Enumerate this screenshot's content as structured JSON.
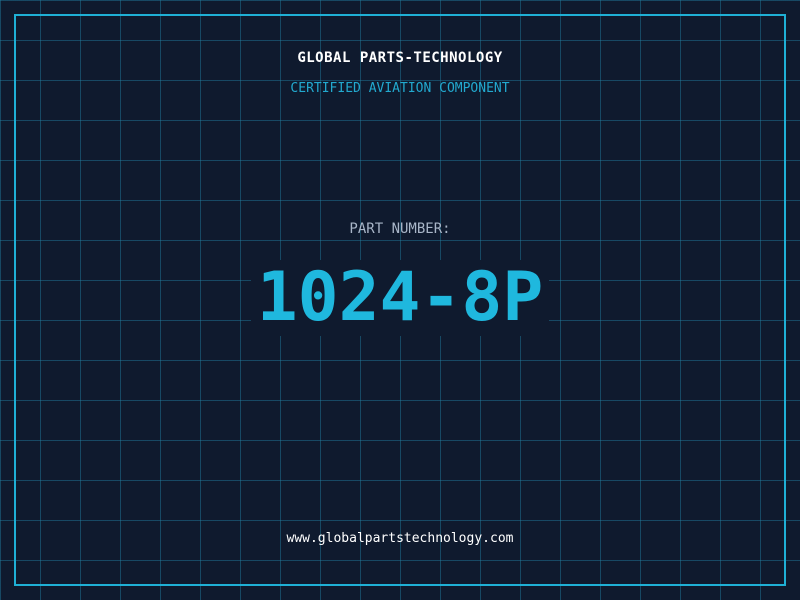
{
  "header": {
    "company_name": "GLOBAL PARTS-TECHNOLOGY",
    "tagline": "CERTIFIED AVIATION COMPONENT"
  },
  "part": {
    "label": "PART NUMBER:",
    "number": "1024-8P"
  },
  "footer": {
    "website": "www.globalpartstechnology.com"
  },
  "colors": {
    "background": "#0f1a2e",
    "accent": "#1fb8de",
    "grid": "#2282a5",
    "text_primary": "#ffffff",
    "text_muted": "#a9b6c8"
  }
}
